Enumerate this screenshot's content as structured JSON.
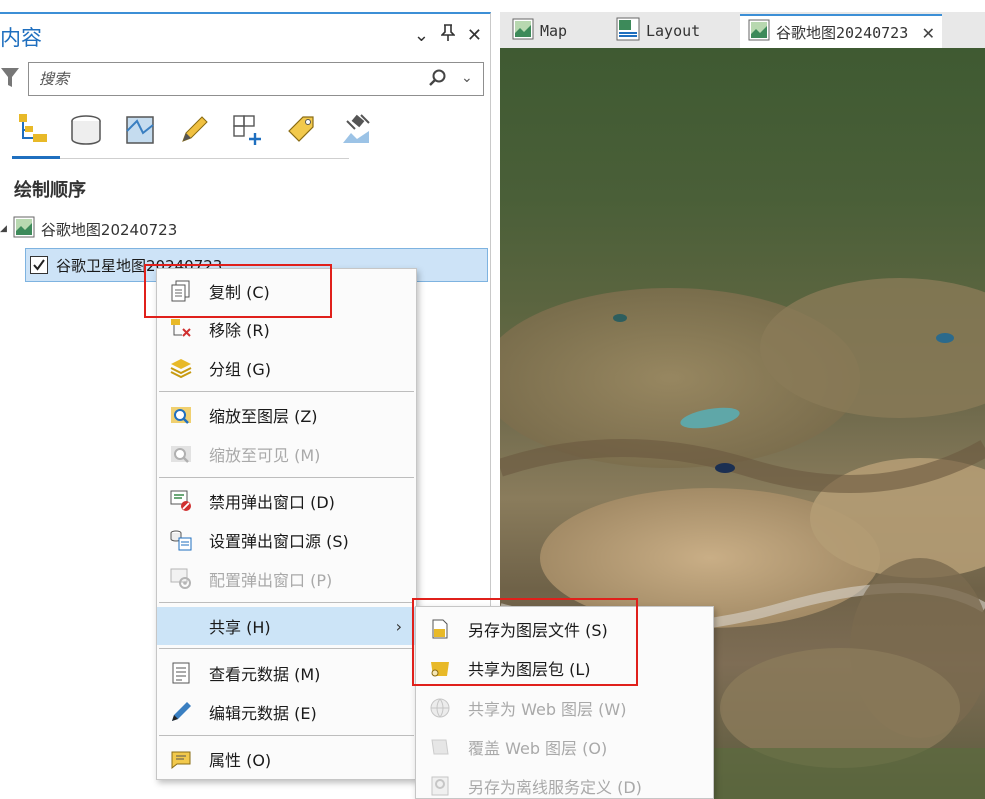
{
  "contents_pane": {
    "title": "内容",
    "search_placeholder": "搜索",
    "section_title": "绘制顺序",
    "map_name": "谷歌地图20240723",
    "layer_name": "谷歌卫星地图20240723"
  },
  "tabs": [
    {
      "label": "Map"
    },
    {
      "label": "Layout"
    },
    {
      "label": "谷歌地图20240723"
    }
  ],
  "context_menu": {
    "items": [
      {
        "label": "复制 (C)",
        "icon": "copy-icon"
      },
      {
        "label": "移除 (R)",
        "icon": "remove-icon"
      },
      {
        "label": "分组 (G)",
        "icon": "group-icon"
      },
      {
        "label": "缩放至图层 (Z)",
        "icon": "zoom-layer-icon"
      },
      {
        "label": "缩放至可见 (M)",
        "icon": "zoom-visible-icon",
        "disabled": true
      },
      {
        "label": "禁用弹出窗口 (D)",
        "icon": "disable-popup-icon"
      },
      {
        "label": "设置弹出窗口源 (S)",
        "icon": "popup-source-icon"
      },
      {
        "label": "配置弹出窗口 (P)",
        "icon": "configure-popup-icon",
        "disabled": true
      },
      {
        "label": "共享 (H)",
        "icon": "share-icon",
        "highlighted": true
      },
      {
        "label": "查看元数据 (M)",
        "icon": "view-metadata-icon"
      },
      {
        "label": "编辑元数据 (E)",
        "icon": "edit-metadata-icon"
      },
      {
        "label": "属性 (O)",
        "icon": "properties-icon"
      }
    ]
  },
  "share_submenu": {
    "items": [
      {
        "label": "另存为图层文件 (S)",
        "icon": "save-layer-file-icon"
      },
      {
        "label": "共享为图层包 (L)",
        "icon": "layer-package-icon"
      },
      {
        "label": "共享为 Web 图层 (W)",
        "icon": "web-layer-icon",
        "disabled": true
      },
      {
        "label": "覆盖 Web 图层 (O)",
        "icon": "overwrite-web-layer-icon",
        "disabled": true
      },
      {
        "label": "另存为离线服务定义 (D)",
        "icon": "offline-service-icon",
        "disabled": true
      }
    ]
  },
  "colors": {
    "accent": "#1f6fbf",
    "highlight": "#cce4f7",
    "annotation_red": "#e0201b"
  }
}
